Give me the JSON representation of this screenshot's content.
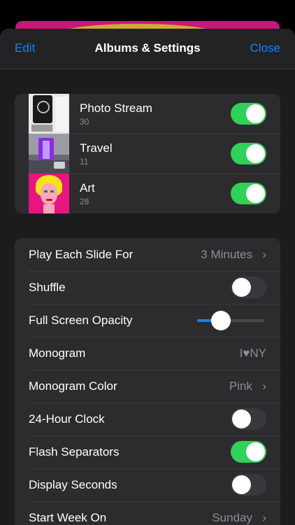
{
  "nav": {
    "left": "Edit",
    "title": "Albums & Settings",
    "right": "Close"
  },
  "albums": [
    {
      "name": "Photo Stream",
      "count": "30",
      "enabled": true
    },
    {
      "name": "Travel",
      "count": "11",
      "enabled": true
    },
    {
      "name": "Art",
      "count": "28",
      "enabled": true
    }
  ],
  "settings": {
    "slide_duration": {
      "label": "Play Each Slide For",
      "value": "3 Minutes"
    },
    "shuffle": {
      "label": "Shuffle",
      "enabled": false
    },
    "opacity": {
      "label": "Full Screen Opacity",
      "level": 0.35
    },
    "monogram": {
      "label": "Monogram",
      "value": "I♥NY"
    },
    "monogram_color": {
      "label": "Monogram Color",
      "value": "Pink"
    },
    "clock_24h": {
      "label": "24-Hour Clock",
      "enabled": false
    },
    "flash_separators": {
      "label": "Flash Separators",
      "enabled": true
    },
    "display_seconds": {
      "label": "Display Seconds",
      "enabled": false
    },
    "start_week": {
      "label": "Start Week On",
      "value": "Sunday"
    }
  },
  "colors": {
    "accent": "#0a84ff",
    "toggle_on": "#30d158",
    "sheet_bg": "#1c1c1e",
    "group_bg": "#2c2c2e"
  }
}
